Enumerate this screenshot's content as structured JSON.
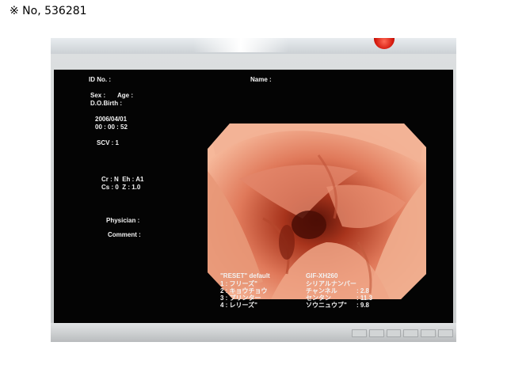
{
  "caption": "※ No, 536281",
  "osd": {
    "id_no": "ID No. :",
    "name": "Name :",
    "sex": "Sex :",
    "age": "Age :",
    "dob": "D.O.Birth :",
    "date": "2006/04/01",
    "time": "00 : 00 : 52",
    "scv": "SCV : 1",
    "settings_line1": "Cr : N  Eh : A1",
    "settings_line2": "Cs : 0  Z : 1.0",
    "physician": "Physician :",
    "comment": "Comment :",
    "reset_default": "\"RESET\" default",
    "menu": [
      "1 : フリーズ\"",
      "2 : キョウチョウ",
      "3 : プリンター",
      "4 : レリーズ\""
    ],
    "scope_model": "GIF-XH260",
    "scope_info_labels": [
      "シリアルナンバー",
      "チャンネル",
      "センタン",
      "ソウニュウブ\""
    ],
    "scope_info_values": [
      "",
      ": 2.8",
      ": 11.3",
      ": 9.8"
    ]
  },
  "colors": {
    "screen": "#040404",
    "mucosa_light": "#f6b89a",
    "mucosa_dark": "#5a1208"
  }
}
